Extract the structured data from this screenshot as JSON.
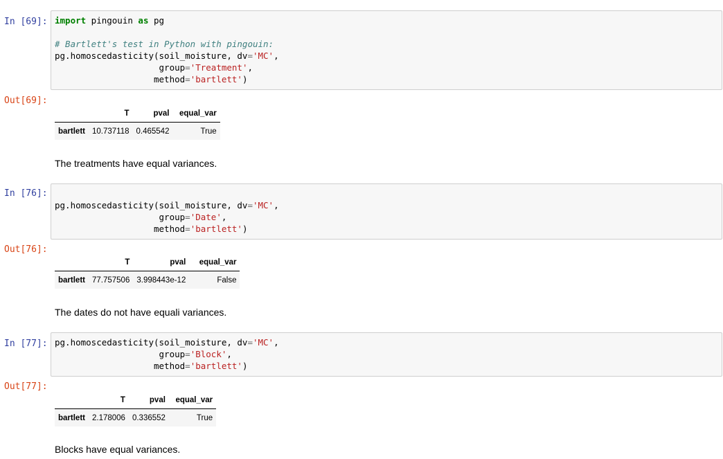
{
  "cells": [
    {
      "in_prompt": "In [69]:",
      "out_prompt": "Out[69]:",
      "code": {
        "l1_kw1": "import",
        "l1_mod": " pingouin ",
        "l1_kw2": "as",
        "l1_alias": " pg",
        "l3_comment": "# Bartlett's test in Python with pingouin:",
        "l4_a": "pg.homoscedasticity(soil_moisture, dv",
        "l4_eq": "=",
        "l4_str": "'MC'",
        "l4_end": ",",
        "l5_a": "                    group",
        "l5_eq": "=",
        "l5_str": "'Treatment'",
        "l5_end": ",",
        "l6_a": "                   method",
        "l6_eq": "=",
        "l6_str": "'bartlett'",
        "l6_end": ")"
      },
      "table": {
        "headers": [
          "",
          "T",
          "pval",
          "equal_var"
        ],
        "row_label": "bartlett",
        "values": [
          "10.737118",
          "0.465542",
          "True"
        ]
      },
      "note": "The treatments have equal variances."
    },
    {
      "in_prompt": "In [76]:",
      "out_prompt": "Out[76]:",
      "code": {
        "l2_a": "pg.homoscedasticity(soil_moisture, dv",
        "l2_eq": "=",
        "l2_str": "'MC'",
        "l2_end": ",",
        "l3_a": "                    group",
        "l3_eq": "=",
        "l3_str": "'Date'",
        "l3_end": ",",
        "l4_a": "                   method",
        "l4_eq": "=",
        "l4_str": "'bartlett'",
        "l4_end": ")"
      },
      "table": {
        "headers": [
          "",
          "T",
          "pval",
          "equal_var"
        ],
        "row_label": "bartlett",
        "values": [
          "77.757506",
          "3.998443e-12",
          "False"
        ]
      },
      "note": "The dates do not have equali variances."
    },
    {
      "in_prompt": "In [77]:",
      "out_prompt": "Out[77]:",
      "code": {
        "l1_a": "pg.homoscedasticity(soil_moisture, dv",
        "l1_eq": "=",
        "l1_str": "'MC'",
        "l1_end": ",",
        "l2_a": "                    group",
        "l2_eq": "=",
        "l2_str": "'Block'",
        "l2_end": ",",
        "l3_a": "                   method",
        "l3_eq": "=",
        "l3_str": "'bartlett'",
        "l3_end": ")"
      },
      "table": {
        "headers": [
          "",
          "T",
          "pval",
          "equal_var"
        ],
        "row_label": "bartlett",
        "values": [
          "2.178006",
          "0.336552",
          "True"
        ]
      },
      "note": "Blocks have equal variances."
    }
  ],
  "colors": {
    "in_prompt": "#303f9f",
    "out_prompt": "#d84315",
    "keyword": "#008000",
    "comment": "#408080",
    "string": "#ba2121",
    "input_bg": "#f7f7f7",
    "input_border": "#cfcfcf"
  }
}
